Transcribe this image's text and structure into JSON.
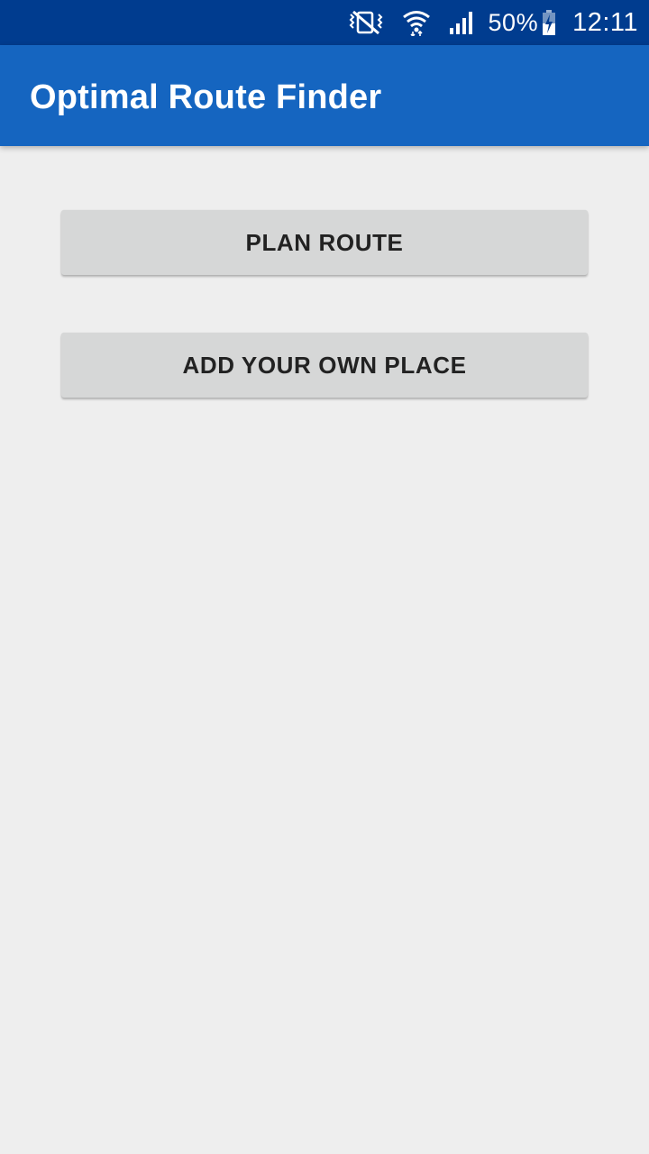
{
  "status_bar": {
    "icons": [
      "vibrate-icon",
      "wifi-icon",
      "signal-icon"
    ],
    "battery_percent": "50%",
    "time": "12:11",
    "background_color": "#003c8f"
  },
  "app_bar": {
    "title": "Optimal Route Finder",
    "background_color": "#1565c0"
  },
  "main": {
    "buttons": [
      {
        "label": "PLAN ROUTE"
      },
      {
        "label": "ADD YOUR OWN PLACE"
      }
    ]
  },
  "colors": {
    "page_background": "#eeeeee",
    "button_background": "#d6d7d7",
    "button_text": "#222222"
  }
}
